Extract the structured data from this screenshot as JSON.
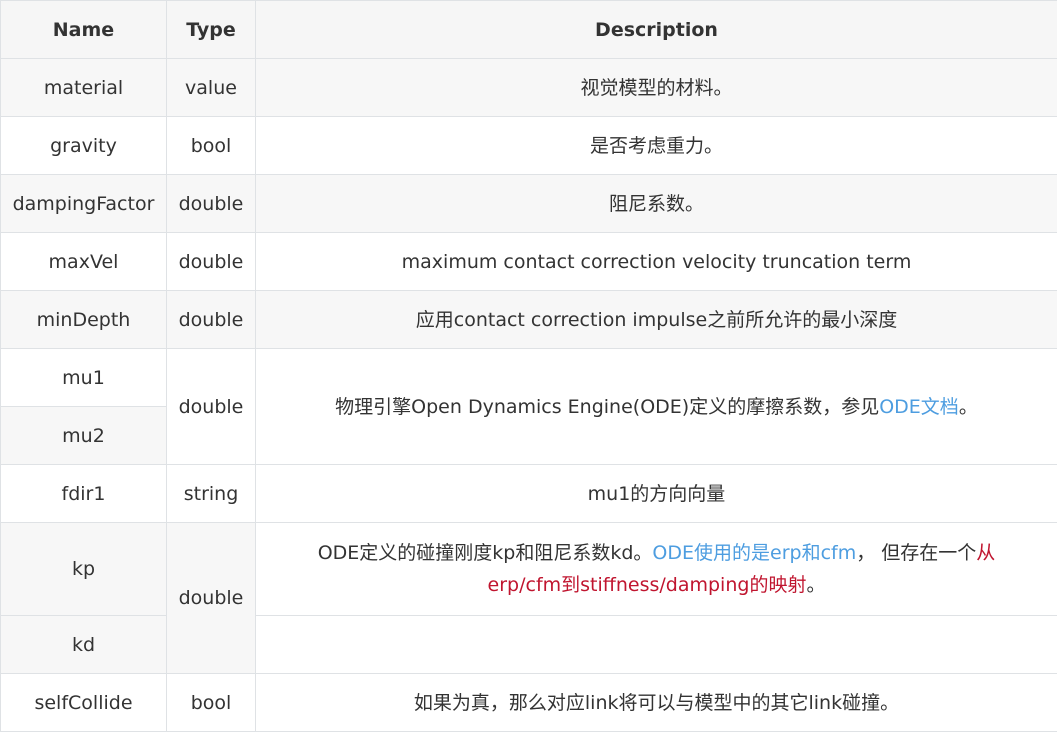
{
  "headers": [
    "Name",
    "Type",
    "Description"
  ],
  "rows": {
    "material": {
      "name": "material",
      "type": "value",
      "desc": "视觉模型的材料。"
    },
    "gravity": {
      "name": "gravity",
      "type": "bool",
      "desc": "是否考虑重力。"
    },
    "dampingFactor": {
      "name": "dampingFactor",
      "type": "double",
      "desc": "阻尼系数。"
    },
    "maxVel": {
      "name": "maxVel",
      "type": "double",
      "desc": "maximum contact correction velocity truncation term"
    },
    "minDepth": {
      "name": "minDepth",
      "type": "double",
      "desc": "应用contact correction impulse之前所允许的最小深度"
    },
    "mu": {
      "name1": "mu1",
      "name2": "mu2",
      "type": "double",
      "desc_prefix": "物理引擎Open Dynamics Engine(ODE)定义的摩擦系数，参见",
      "desc_link": "ODE文档",
      "desc_suffix": "。"
    },
    "fdir1": {
      "name": "fdir1",
      "type": "string",
      "desc": "mu1的方向向量"
    },
    "kpkd": {
      "name1": "kp",
      "name2": "kd",
      "type": "double",
      "desc_plain": "ODE定义的碰撞刚度kp和阻尼系数kd。",
      "desc_link": "ODE使用的是erp和cfm",
      "desc_mid": "， 但存在一个",
      "desc_red": "从erp/cfm到stiffness/damping的映射",
      "desc_end": "。"
    },
    "selfCollide": {
      "name": "selfCollide",
      "type": "bool",
      "desc": "如果为真，那么对应link将可以与模型中的其它link碰撞。"
    }
  }
}
